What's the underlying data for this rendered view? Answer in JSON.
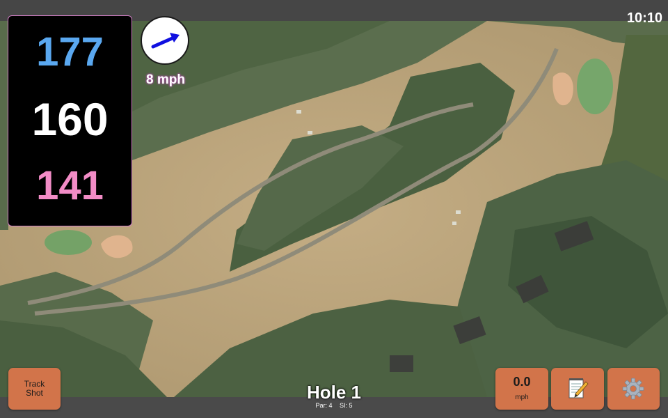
{
  "status_bar": {
    "time": "10:10"
  },
  "distances": {
    "back": "177",
    "center": "160",
    "front": "141",
    "colors": {
      "back": "#5aa8f0",
      "center": "#ffffff",
      "front": "#f28cc6"
    }
  },
  "wind": {
    "speed_label": "8 mph",
    "icon": "wind-direction-arrow",
    "arrow_color": "#1010e0"
  },
  "hole": {
    "title": "Hole 1",
    "par_label": "Par: 4",
    "si_label": "SI: 5"
  },
  "buttons": {
    "track_shot_line1": "Track",
    "track_shot_line2": "Shot",
    "speed_value": "0.0",
    "speed_unit": "mph",
    "notes_icon": "notepad-pencil-icon",
    "settings_icon": "gear-icon",
    "button_color": "#d2744a"
  },
  "map": {
    "view": "aerial satellite view of golf hole"
  }
}
